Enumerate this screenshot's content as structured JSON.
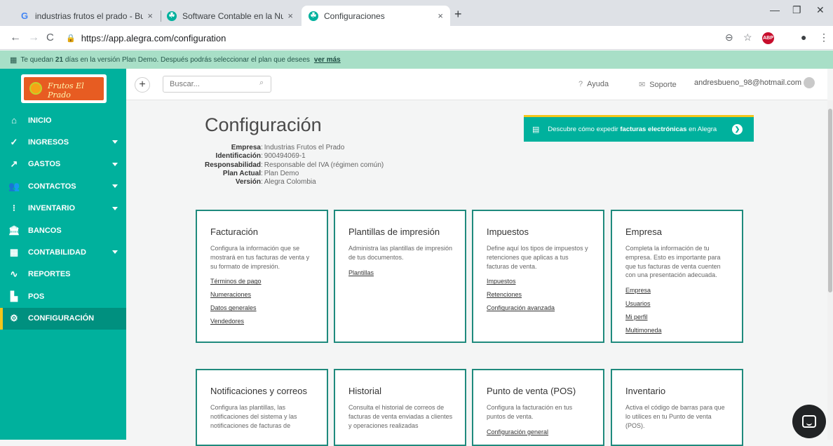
{
  "browser": {
    "tabs": [
      {
        "title": "industrias frutos el prado - Busca",
        "favicon": "G",
        "close": "×"
      },
      {
        "title": "Software Contable en la Nube pa",
        "favicon": "☘",
        "close": "×"
      },
      {
        "title": "Configuraciones",
        "favicon": "☘",
        "close": "×",
        "active": true
      }
    ],
    "new_tab": "+",
    "url": "https://app.alegra.com/configuration",
    "window_controls": {
      "minimize": "—",
      "restore": "❐",
      "close": "✕"
    },
    "nav": {
      "back": "←",
      "forward": "→",
      "reload": "C"
    },
    "toolbar_icons": {
      "zoom": "⊖",
      "star": "☆",
      "abp": "ABP",
      "account": "●",
      "menu": "⋮"
    }
  },
  "banner": {
    "prefix": "Te quedan",
    "days": "21",
    "suffix": "días en la versión Plan Demo. Después podrás seleccionar el plan que desees",
    "link": "ver más"
  },
  "sidebar": {
    "logo_text": "Frutos El Prado",
    "items": [
      {
        "label": "INICIO",
        "icon": "home-icon",
        "glyph": "⌂",
        "caret": false
      },
      {
        "label": "INGRESOS",
        "icon": "income-icon",
        "glyph": "✓",
        "caret": true
      },
      {
        "label": "GASTOS",
        "icon": "expenses-icon",
        "glyph": "↗",
        "caret": true
      },
      {
        "label": "CONTACTOS",
        "icon": "contacts-icon",
        "glyph": "👥",
        "caret": true
      },
      {
        "label": "INVENTARIO",
        "icon": "inventory-icon",
        "glyph": "⁝",
        "caret": true
      },
      {
        "label": "BANCOS",
        "icon": "bank-icon",
        "glyph": "🏛",
        "caret": false
      },
      {
        "label": "CONTABILIDAD",
        "icon": "accounting-icon",
        "glyph": "▦",
        "caret": true
      },
      {
        "label": "REPORTES",
        "icon": "reports-icon",
        "glyph": "∿",
        "caret": false
      },
      {
        "label": "POS",
        "icon": "pos-icon",
        "glyph": "▙",
        "caret": false
      },
      {
        "label": "CONFIGURACIÓN",
        "icon": "gear-icon",
        "glyph": "⚙",
        "caret": false,
        "active": true
      }
    ]
  },
  "header": {
    "search_placeholder": "Buscar...",
    "help": "Ayuda",
    "support": "Soporte",
    "user": "andresbueno_98@hotmail.com"
  },
  "page": {
    "title": "Configuración",
    "meta": [
      {
        "key": "Empresa",
        "value": "Industrias Frutos el Prado"
      },
      {
        "key": "Identificación",
        "value": "900494069-1"
      },
      {
        "key": "Responsabilidad",
        "value": "Responsable del IVA (régimen común)"
      },
      {
        "key": "Plan Actual",
        "value": "Plan Demo"
      },
      {
        "key": "Versión",
        "value": "Alegra Colombia"
      }
    ],
    "promo": {
      "prefix": "Descubre cómo expedir",
      "bold": "facturas electrónicas",
      "suffix": "en Alegra"
    }
  },
  "cards": [
    {
      "title": "Facturación",
      "desc": "Configura la información que se mostrará en tus facturas de venta y su formato de impresión.",
      "links": [
        "Términos de pago",
        "Numeraciones",
        "Datos generales",
        "Vendedores"
      ]
    },
    {
      "title": "Plantillas de impresión",
      "desc": "Administra las plantillas de impresión de tus documentos.",
      "links": [
        "Plantillas"
      ]
    },
    {
      "title": "Impuestos",
      "desc": "Define aquí los tipos de impuestos y retenciones que aplicas a tus facturas de venta.",
      "links": [
        "Impuestos",
        "Retenciones",
        "Configuración avanzada"
      ]
    },
    {
      "title": "Empresa",
      "desc": "Completa la información de tu empresa. Esto es importante para que tus facturas de venta cuenten con una presentación adecuada.",
      "links": [
        "Empresa",
        "Usuarios",
        "Mi perfil",
        "Multimoneda"
      ]
    },
    {
      "title": "Notificaciones y correos",
      "desc": "Configura las plantillas, las notificaciones del sistema y las notificaciones de facturas de",
      "links": []
    },
    {
      "title": "Historial",
      "desc": "Consulta el historial de correos de facturas de venta enviadas a clientes y operaciones realizadas",
      "links": []
    },
    {
      "title": "Punto de venta (POS)",
      "desc": "Configura la facturación en tus puntos de venta.",
      "links": [
        "Configuración general"
      ]
    },
    {
      "title": "Inventario",
      "desc": "Activa el código de barras para que lo utilices en tu Punto de venta (POS).",
      "links": []
    }
  ]
}
